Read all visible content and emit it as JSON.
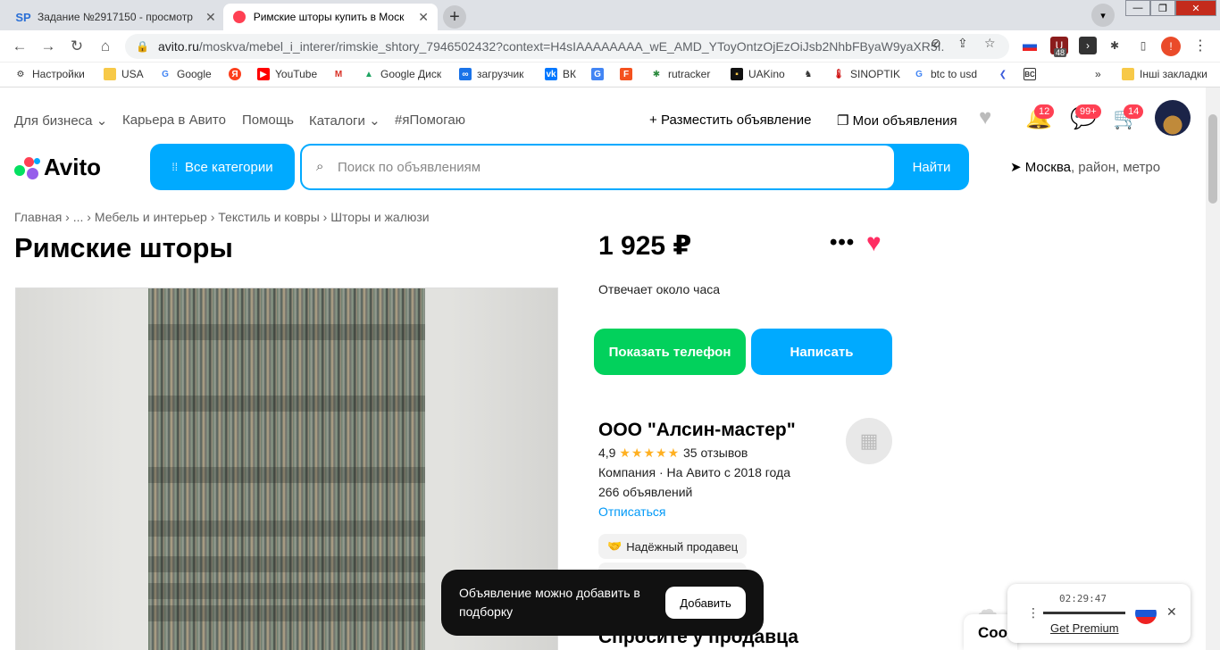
{
  "browser": {
    "tabs": [
      {
        "favicon": "SP",
        "title": "Задание №2917150 - просмотр",
        "active": false
      },
      {
        "favicon": "avito-icon",
        "title": "Римские шторы купить в Моск",
        "active": true
      }
    ],
    "url_domain": "avito.ru",
    "url_path": "/moskva/mebel_i_interer/rimskie_shtory_7946502432?context=H4sIAAAAAAAA_wE_AMD_YToyOntzOjEzOiJsb2NhbFByaW9yaXR5I...",
    "extension_badge": "48",
    "profile_initial": "!",
    "bookmarks": [
      "Настройки",
      "USA",
      "Google",
      "YouTube",
      "Google Диск",
      "загрузчик",
      "ВК",
      "rutracker",
      "UAKino",
      "SINOPTIK",
      "btc to usd",
      "Інші закладки"
    ],
    "bookmarks_more": "»"
  },
  "header": {
    "nav": [
      "Для бизнеса",
      "Карьера в Авито",
      "Помощь",
      "Каталоги",
      "#яПомогаю"
    ],
    "post_ad": "Разместить объявление",
    "my_ads": "Мои объявления",
    "counts": {
      "notifications": "12",
      "messages": "99+",
      "cart": "14"
    },
    "logo": "Avito",
    "all_categories": "Все категории",
    "search_placeholder": "Поиск по объявлениям",
    "search_button": "Найти",
    "location_city": "Москва",
    "location_rest": ", район, метро"
  },
  "breadcrumbs": [
    "Главная",
    "...",
    "Мебель и интерьер",
    "Текстиль и ковры",
    "Шторы и жалюзи"
  ],
  "listing": {
    "title": "Римские шторы",
    "price": "1 925 ₽",
    "reply_time": "Отвечает около часа",
    "show_phone": "Показать телефон",
    "write": "Написать"
  },
  "seller": {
    "name": "ООО \"Алсин-мастер\"",
    "rating": "4,9",
    "stars": "★★★★★",
    "reviews": "35 отзывов",
    "type_since": "Компания · На Авито с 2018 года",
    "ads_count": "266 объявлений",
    "unsubscribe": "Отписаться",
    "badge": "Надёжный продавец"
  },
  "toast": {
    "message": "Объявление можно добавить в подборку",
    "button": "Добавить"
  },
  "ask_seller": "Спросите у продавца",
  "chat_stub": "Соо",
  "extension_panel": {
    "time": "02:29:47",
    "premium": "Get Premium"
  },
  "colors": {
    "brand_blue": "#00aaff",
    "green": "#02d15c",
    "heart": "#ff2e63",
    "badge_red": "#ff4053"
  }
}
